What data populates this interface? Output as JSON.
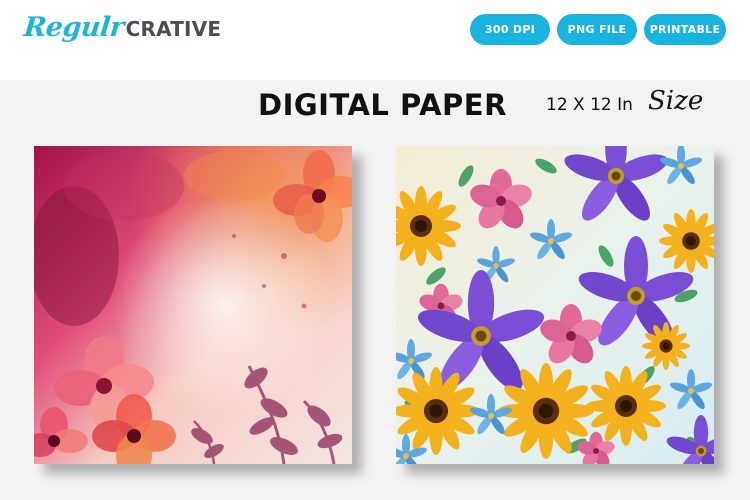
{
  "brand": {
    "script_part": "Regulr",
    "block_part": "CRATIVE"
  },
  "badges": [
    "300 DPI",
    "PNG FILE",
    "PRINTABLE"
  ],
  "headline": {
    "title": "DIGITAL PAPER",
    "size_text": "12 X 12 In",
    "size_word": "Size"
  },
  "colors": {
    "brand_cyan": "#1fb6d6",
    "brand_gray": "#4a4f56",
    "badge_bg": "#19b3e0",
    "background": "#f3f3f3"
  },
  "papers": [
    {
      "style": "pink-red watercolor with flowers and leaf silhouettes"
    },
    {
      "style": "colorful watercolor floral pattern: purple, yellow, blue, pink flowers"
    }
  ]
}
